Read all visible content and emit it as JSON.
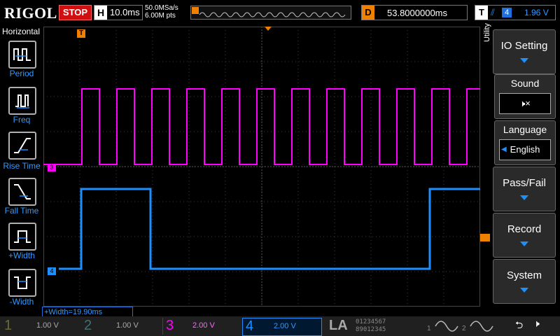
{
  "brand": "RIGOL",
  "run_state": "STOP",
  "horizontal": {
    "key": "H",
    "timebase": "10.0ms",
    "sample_rate": "50.0MSa/s",
    "memory": "6.00M pts"
  },
  "delay": {
    "key": "D",
    "value": "53.8000000ms"
  },
  "trigger": {
    "key": "T",
    "edge": "rising-edge-icon",
    "source": "4",
    "level": "1.96 V"
  },
  "left_menu": {
    "title": "Horizontal",
    "items": [
      {
        "label": "Period",
        "icon": "period-icon"
      },
      {
        "label": "Freq",
        "icon": "frequency-icon"
      },
      {
        "label": "Rise Time",
        "icon": "rise-time-icon"
      },
      {
        "label": "Fall Time",
        "icon": "fall-time-icon"
      },
      {
        "label": "+Width",
        "icon": "positive-width-icon"
      },
      {
        "label": "-Width",
        "icon": "negative-width-icon"
      }
    ]
  },
  "right_menu": {
    "tab": "Utility",
    "io_setting": "IO Setting",
    "sound": {
      "label": "Sound",
      "icon": "speaker-muted-icon"
    },
    "language": {
      "label": "Language",
      "value": "English"
    },
    "pass_fail": "Pass/Fail",
    "record": "Record",
    "system": "System"
  },
  "measurement": "+Width=19.90ms",
  "markers": {
    "ch3": "3",
    "ch4": "4",
    "trigger": "T"
  },
  "channels": [
    {
      "num": "1",
      "scale": "1.00 V",
      "color": "#f0f000"
    },
    {
      "num": "2",
      "scale": "1.00 V",
      "color": "#00e0e0"
    },
    {
      "num": "3",
      "scale": "2.00 V",
      "color": "#ff00ff"
    },
    {
      "num": "4",
      "scale": "2.00 V",
      "color": "#1e8fff"
    }
  ],
  "la": {
    "label": "LA",
    "digits_top": "01234567",
    "digits_bottom": "89012345"
  },
  "gen": [
    {
      "num": "1"
    },
    {
      "num": "2"
    }
  ],
  "colors": {
    "ch3": "#ff00ff",
    "ch4": "#1e8fff",
    "grid": "#555555",
    "stop": "#d01010"
  }
}
